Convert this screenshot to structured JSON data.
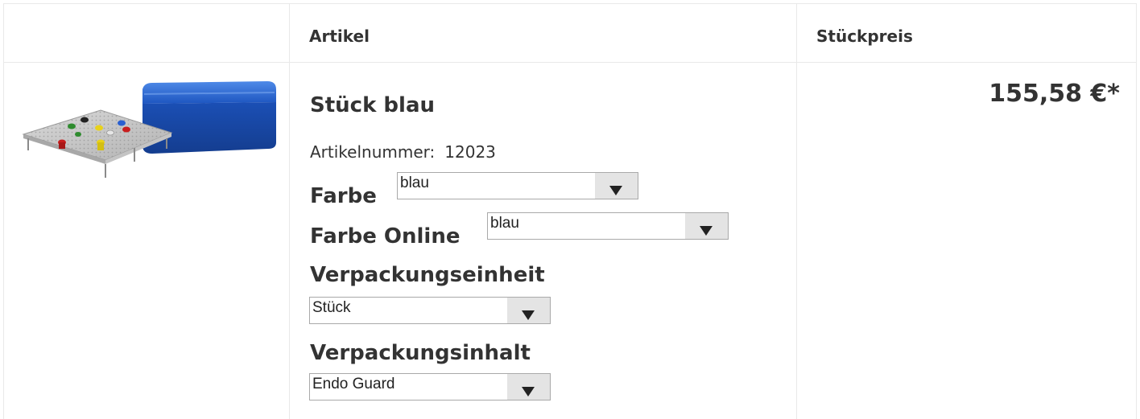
{
  "header": {
    "artikel": "Artikel",
    "stueckpreis": "Stückpreis"
  },
  "product": {
    "title": "Stück blau",
    "artnr_label": "Artikelnummer:",
    "artnr_value": "12023",
    "price": "155,58 €*",
    "image_icon": "instrument-tray-with-blue-box"
  },
  "options": {
    "farbe": {
      "label": "Farbe",
      "value": "blau"
    },
    "farbe_online": {
      "label": "Farbe Online",
      "value": "blau"
    },
    "verpackungseinheit": {
      "label": "Verpackungseinheit",
      "value": "Stück"
    },
    "verpackungsinhalt": {
      "label": "Verpackungsinhalt",
      "value": "Endo Guard"
    }
  },
  "colors": {
    "text": "#333333",
    "border": "#e9e9e9",
    "select_arrow_bg": "#e4e4e4",
    "box_blue": "#1e5fc8"
  }
}
